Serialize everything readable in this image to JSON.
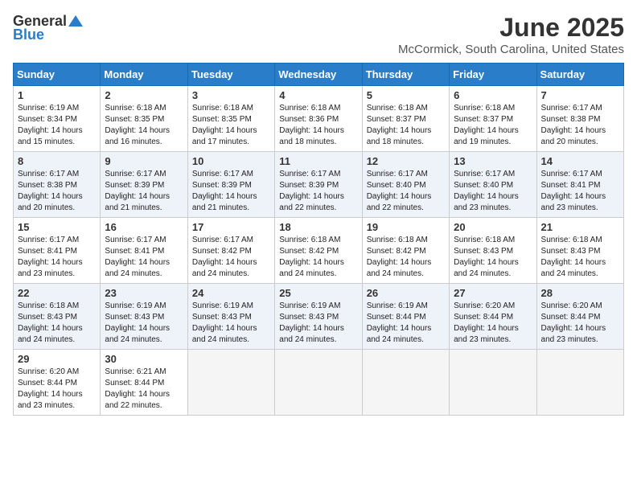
{
  "header": {
    "logo_general": "General",
    "logo_blue": "Blue",
    "month": "June 2025",
    "location": "McCormick, South Carolina, United States"
  },
  "weekdays": [
    "Sunday",
    "Monday",
    "Tuesday",
    "Wednesday",
    "Thursday",
    "Friday",
    "Saturday"
  ],
  "weeks": [
    [
      {
        "day": "1",
        "sunrise": "6:19 AM",
        "sunset": "8:34 PM",
        "daylight": "14 hours and 15 minutes."
      },
      {
        "day": "2",
        "sunrise": "6:18 AM",
        "sunset": "8:35 PM",
        "daylight": "14 hours and 16 minutes."
      },
      {
        "day": "3",
        "sunrise": "6:18 AM",
        "sunset": "8:35 PM",
        "daylight": "14 hours and 17 minutes."
      },
      {
        "day": "4",
        "sunrise": "6:18 AM",
        "sunset": "8:36 PM",
        "daylight": "14 hours and 18 minutes."
      },
      {
        "day": "5",
        "sunrise": "6:18 AM",
        "sunset": "8:37 PM",
        "daylight": "14 hours and 18 minutes."
      },
      {
        "day": "6",
        "sunrise": "6:18 AM",
        "sunset": "8:37 PM",
        "daylight": "14 hours and 19 minutes."
      },
      {
        "day": "7",
        "sunrise": "6:17 AM",
        "sunset": "8:38 PM",
        "daylight": "14 hours and 20 minutes."
      }
    ],
    [
      {
        "day": "8",
        "sunrise": "6:17 AM",
        "sunset": "8:38 PM",
        "daylight": "14 hours and 20 minutes."
      },
      {
        "day": "9",
        "sunrise": "6:17 AM",
        "sunset": "8:39 PM",
        "daylight": "14 hours and 21 minutes."
      },
      {
        "day": "10",
        "sunrise": "6:17 AM",
        "sunset": "8:39 PM",
        "daylight": "14 hours and 21 minutes."
      },
      {
        "day": "11",
        "sunrise": "6:17 AM",
        "sunset": "8:39 PM",
        "daylight": "14 hours and 22 minutes."
      },
      {
        "day": "12",
        "sunrise": "6:17 AM",
        "sunset": "8:40 PM",
        "daylight": "14 hours and 22 minutes."
      },
      {
        "day": "13",
        "sunrise": "6:17 AM",
        "sunset": "8:40 PM",
        "daylight": "14 hours and 23 minutes."
      },
      {
        "day": "14",
        "sunrise": "6:17 AM",
        "sunset": "8:41 PM",
        "daylight": "14 hours and 23 minutes."
      }
    ],
    [
      {
        "day": "15",
        "sunrise": "6:17 AM",
        "sunset": "8:41 PM",
        "daylight": "14 hours and 23 minutes."
      },
      {
        "day": "16",
        "sunrise": "6:17 AM",
        "sunset": "8:41 PM",
        "daylight": "14 hours and 24 minutes."
      },
      {
        "day": "17",
        "sunrise": "6:17 AM",
        "sunset": "8:42 PM",
        "daylight": "14 hours and 24 minutes."
      },
      {
        "day": "18",
        "sunrise": "6:18 AM",
        "sunset": "8:42 PM",
        "daylight": "14 hours and 24 minutes."
      },
      {
        "day": "19",
        "sunrise": "6:18 AM",
        "sunset": "8:42 PM",
        "daylight": "14 hours and 24 minutes."
      },
      {
        "day": "20",
        "sunrise": "6:18 AM",
        "sunset": "8:43 PM",
        "daylight": "14 hours and 24 minutes."
      },
      {
        "day": "21",
        "sunrise": "6:18 AM",
        "sunset": "8:43 PM",
        "daylight": "14 hours and 24 minutes."
      }
    ],
    [
      {
        "day": "22",
        "sunrise": "6:18 AM",
        "sunset": "8:43 PM",
        "daylight": "14 hours and 24 minutes."
      },
      {
        "day": "23",
        "sunrise": "6:19 AM",
        "sunset": "8:43 PM",
        "daylight": "14 hours and 24 minutes."
      },
      {
        "day": "24",
        "sunrise": "6:19 AM",
        "sunset": "8:43 PM",
        "daylight": "14 hours and 24 minutes."
      },
      {
        "day": "25",
        "sunrise": "6:19 AM",
        "sunset": "8:43 PM",
        "daylight": "14 hours and 24 minutes."
      },
      {
        "day": "26",
        "sunrise": "6:19 AM",
        "sunset": "8:44 PM",
        "daylight": "14 hours and 24 minutes."
      },
      {
        "day": "27",
        "sunrise": "6:20 AM",
        "sunset": "8:44 PM",
        "daylight": "14 hours and 23 minutes."
      },
      {
        "day": "28",
        "sunrise": "6:20 AM",
        "sunset": "8:44 PM",
        "daylight": "14 hours and 23 minutes."
      }
    ],
    [
      {
        "day": "29",
        "sunrise": "6:20 AM",
        "sunset": "8:44 PM",
        "daylight": "14 hours and 23 minutes."
      },
      {
        "day": "30",
        "sunrise": "6:21 AM",
        "sunset": "8:44 PM",
        "daylight": "14 hours and 22 minutes."
      },
      null,
      null,
      null,
      null,
      null
    ]
  ],
  "labels": {
    "sunrise": "Sunrise:",
    "sunset": "Sunset:",
    "daylight": "Daylight:"
  }
}
